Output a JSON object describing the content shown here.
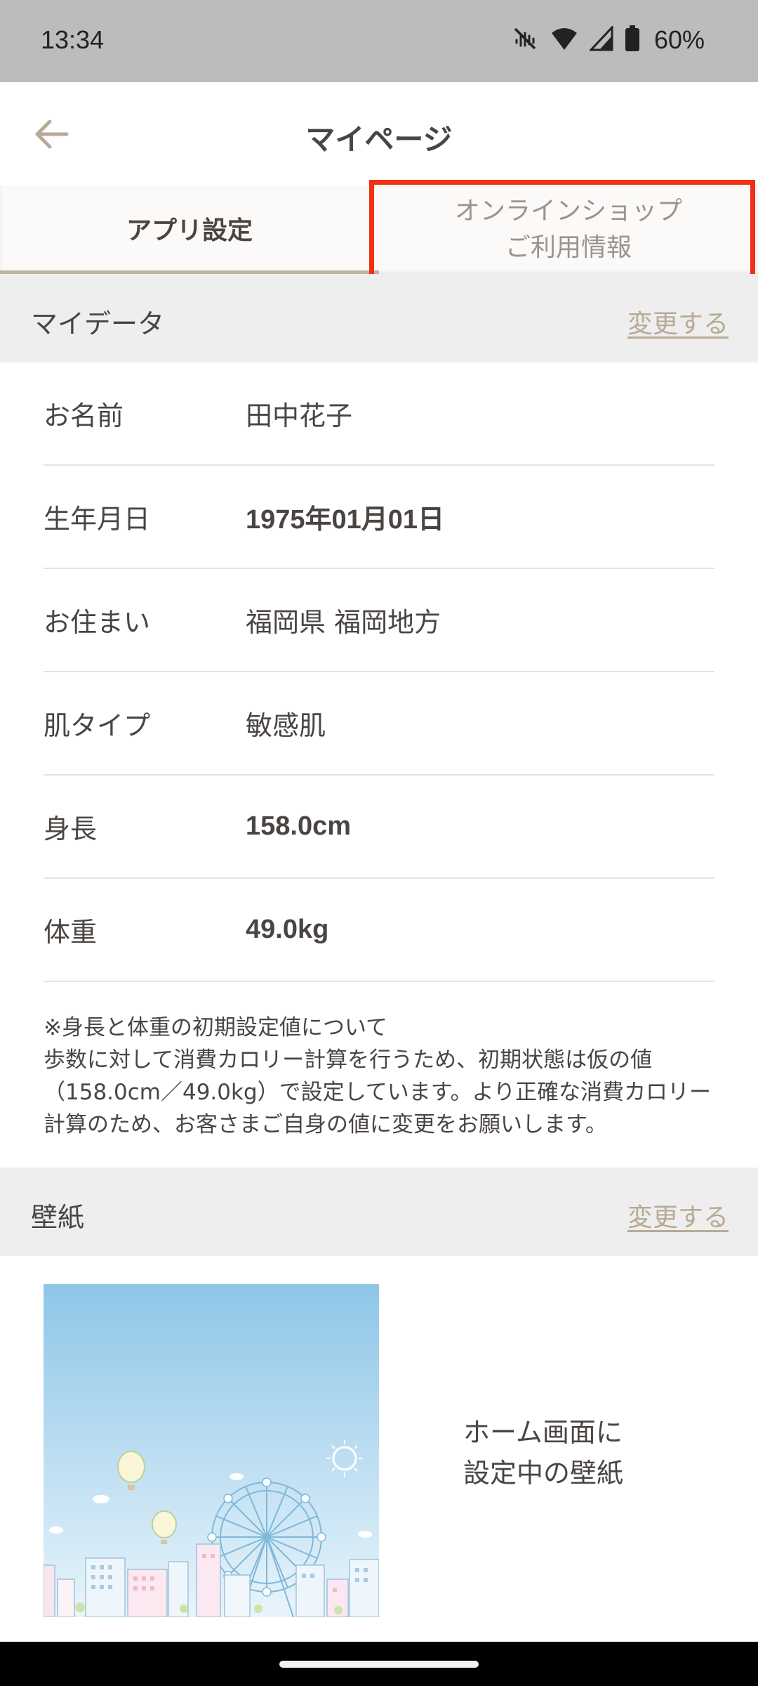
{
  "status_bar": {
    "time": "13:34",
    "battery": "60%",
    "icons": [
      "mute-icon",
      "wifi-icon",
      "signal-icon",
      "battery-icon"
    ]
  },
  "header": {
    "title": "マイページ",
    "back_icon": "back-arrow-icon"
  },
  "tabs": [
    {
      "label": "アプリ設定",
      "selected": true
    },
    {
      "label": "オンラインショップ\nご利用情報",
      "selected": false
    }
  ],
  "my_data": {
    "title": "マイデータ",
    "change_link": "変更する",
    "rows": [
      {
        "label": "お名前",
        "value": "田中花子"
      },
      {
        "label": "生年月日",
        "value": "1975年01月01日"
      },
      {
        "label": "お住まい",
        "value": "福岡県 福岡地方"
      },
      {
        "label": "肌タイプ",
        "value": "敏感肌"
      },
      {
        "label": "身長",
        "value": "158.0cm"
      },
      {
        "label": "体重",
        "value": "49.0kg"
      }
    ],
    "note_lines": [
      "※身長と体重の初期設定値について",
      "歩数に対して消費カロリー計算を行うため、初期状態は仮の値",
      "（158.0cm／49.0kg）で設定しています。より正確な消費カロリー",
      "計算のため、お客さまご自身の値に変更をお願いします。"
    ]
  },
  "wallpaper": {
    "title": "壁紙",
    "change_link": "変更する",
    "caption": "ホーム画面に\n設定中の壁紙"
  },
  "colors": {
    "accent": "#b7aa96",
    "highlight": "#f03010",
    "section_bg": "#eeeeee",
    "sky": "#8ec6e8"
  }
}
